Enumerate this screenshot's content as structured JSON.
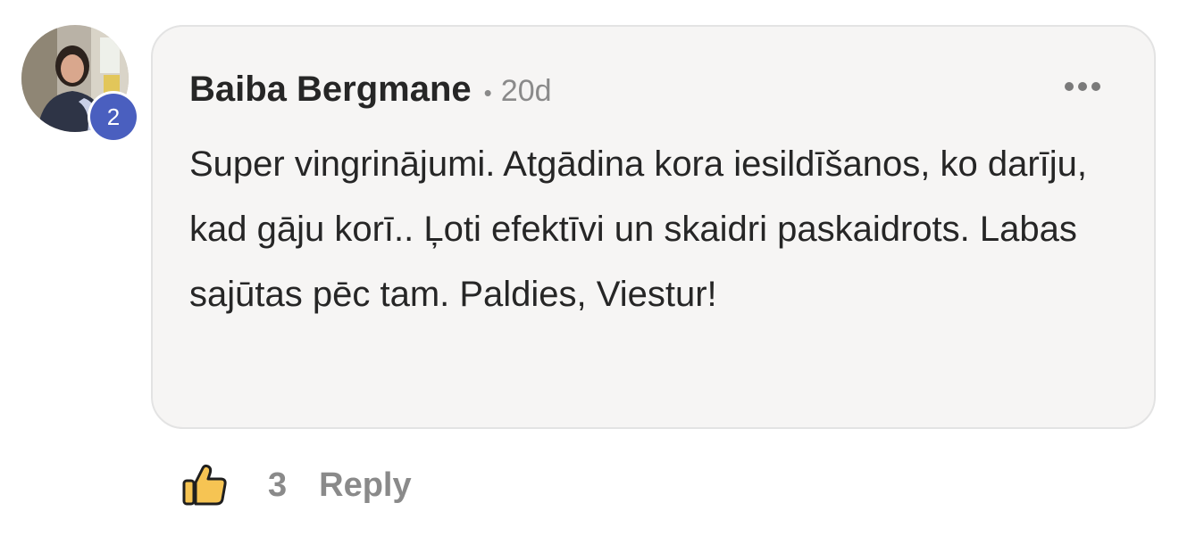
{
  "comment": {
    "author": "Baiba Bergmane",
    "separator": "•",
    "timestamp": "20d",
    "text": "Super vingrinājumi. Atgādina kora iesildīšanos, ko darīju, kad gāju korī.. Ļoti efektīvi un skaidri paskaidrots. Labas sajūtas pēc tam. Paldies, Viestur!",
    "avatar_badge": "2"
  },
  "actions": {
    "like_count": "3",
    "reply_label": "Reply"
  },
  "icons": {
    "more": "more-horizontal-icon",
    "like": "thumbs-up-icon"
  },
  "colors": {
    "bubble_background": "#f6f5f4",
    "badge": "#4a5fbf",
    "like_fill": "#f6c453",
    "muted_text": "#8a8a8a"
  }
}
